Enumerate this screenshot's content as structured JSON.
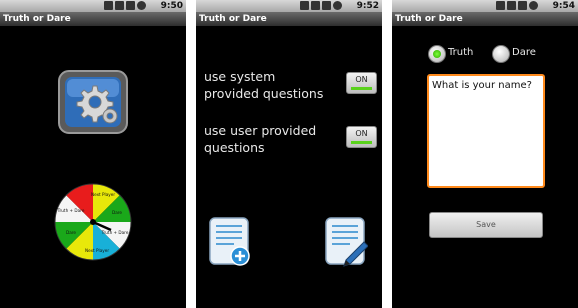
{
  "screens": [
    {
      "status_time": "9:50",
      "app_title": "Truth or Dare",
      "wheel_labels": [
        "Next Player",
        "Dare",
        "Truth + Dare",
        "Next Player",
        "Dare",
        "Truth + Dare"
      ]
    },
    {
      "status_time": "9:52",
      "app_title": "Truth or Dare",
      "options": [
        {
          "label": "use system provided questions",
          "toggle": "ON"
        },
        {
          "label": "use user provided questions",
          "toggle": "ON"
        }
      ]
    },
    {
      "status_time": "9:54",
      "app_title": "Truth or Dare",
      "radio_truth": "Truth",
      "radio_dare": "Dare",
      "question_text": "What is your name?",
      "save_label": "Save"
    }
  ],
  "colors": {
    "toggle_on": "#5ad21c",
    "focus_border": "#ff8a1c",
    "wheel": [
      "#e8e80a",
      "#1aa81a",
      "#e81c1c",
      "#1a3ce8",
      "#f5f5f5",
      "#18b0d8",
      "#e8e80a",
      "#1aa81a"
    ]
  }
}
